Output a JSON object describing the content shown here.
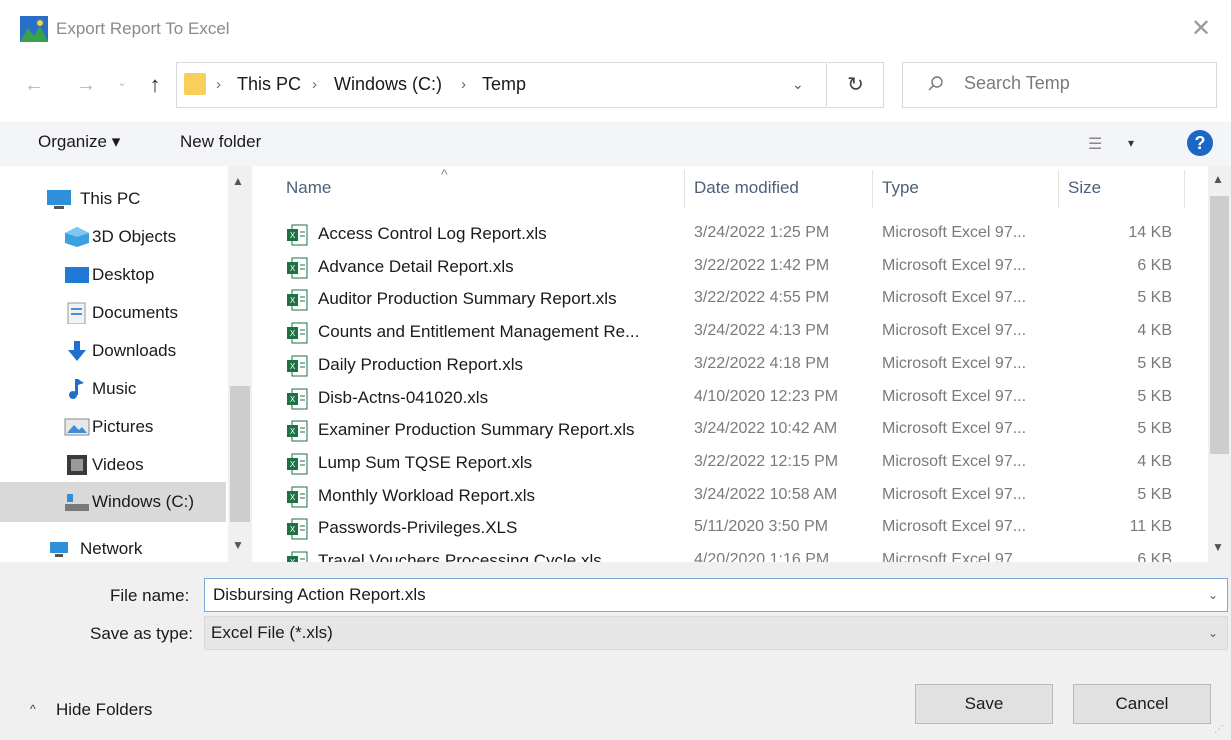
{
  "window": {
    "title": "Export Report To Excel",
    "close_glyph": "✕"
  },
  "nav": {
    "back_glyph": "←",
    "forward_glyph": "→",
    "recent_glyph": "⌄",
    "up_glyph": "↑",
    "breadcrumb": [
      "This PC",
      "Windows (C:)",
      "Temp"
    ],
    "separator": "›",
    "dropdown_glyph": "⌄",
    "refresh_glyph": "↻"
  },
  "search": {
    "placeholder": "Search Temp"
  },
  "toolbar": {
    "organize": "Organize ▾",
    "new_folder": "New folder",
    "view_glyph": "☰",
    "view_caret": "▾",
    "help": "?"
  },
  "sidebar": {
    "items": [
      {
        "label": "This PC",
        "icon": "pc-icon"
      },
      {
        "label": "3D Objects",
        "icon": "cube-icon"
      },
      {
        "label": "Desktop",
        "icon": "desktop-icon"
      },
      {
        "label": "Documents",
        "icon": "documents-icon"
      },
      {
        "label": "Downloads",
        "icon": "download-icon"
      },
      {
        "label": "Music",
        "icon": "music-icon"
      },
      {
        "label": "Pictures",
        "icon": "pictures-icon"
      },
      {
        "label": "Videos",
        "icon": "videos-icon"
      },
      {
        "label": "Windows (C:)",
        "icon": "drive-icon",
        "selected": true
      },
      {
        "label": "Network",
        "icon": "network-icon"
      }
    ],
    "scroll_up": "▲",
    "scroll_down": "▼"
  },
  "file_list": {
    "columns": {
      "name": "Name",
      "date": "Date modified",
      "type": "Type",
      "size": "Size"
    },
    "sort_glyph": "^",
    "rows": [
      {
        "name": "Access Control Log Report.xls",
        "date": "3/24/2022 1:25 PM",
        "type": "Microsoft Excel 97...",
        "size": "14 KB"
      },
      {
        "name": "Advance Detail Report.xls",
        "date": "3/22/2022 1:42 PM",
        "type": "Microsoft Excel 97...",
        "size": "6 KB"
      },
      {
        "name": "Auditor Production Summary Report.xls",
        "date": "3/22/2022 4:55 PM",
        "type": "Microsoft Excel 97...",
        "size": "5 KB"
      },
      {
        "name": "Counts and Entitlement Management Re...",
        "date": "3/24/2022 4:13 PM",
        "type": "Microsoft Excel 97...",
        "size": "4 KB"
      },
      {
        "name": "Daily Production Report.xls",
        "date": "3/22/2022 4:18 PM",
        "type": "Microsoft Excel 97...",
        "size": "5 KB"
      },
      {
        "name": "Disb-Actns-041020.xls",
        "date": "4/10/2020 12:23 PM",
        "type": "Microsoft Excel 97...",
        "size": "5 KB"
      },
      {
        "name": "Examiner Production Summary Report.xls",
        "date": "3/24/2022 10:42 AM",
        "type": "Microsoft Excel 97...",
        "size": "5 KB"
      },
      {
        "name": "Lump Sum TQSE  Report.xls",
        "date": "3/22/2022 12:15 PM",
        "type": "Microsoft Excel 97...",
        "size": "4 KB"
      },
      {
        "name": "Monthly Workload Report.xls",
        "date": "3/24/2022 10:58 AM",
        "type": "Microsoft Excel 97...",
        "size": "5 KB"
      },
      {
        "name": "Passwords-Privileges.XLS",
        "date": "5/11/2020 3:50 PM",
        "type": "Microsoft Excel 97...",
        "size": "11 KB"
      },
      {
        "name": "Travel Vouchers Processing Cycle.xls",
        "date": "4/20/2020 1:16 PM",
        "type": "Microsoft Excel 97...",
        "size": "6 KB"
      }
    ],
    "scroll_up": "▲",
    "scroll_down": "▼"
  },
  "bottom": {
    "filename_label": "File name:",
    "filename_value": "Disbursing Action Report.xls",
    "savetype_label": "Save as type:",
    "savetype_value": "Excel File (*.xls)",
    "dropdown_glyph": "⌄",
    "hide_folders": "Hide Folders",
    "hide_caret": "^",
    "save": "Save",
    "cancel": "Cancel",
    "grip": "⋰"
  },
  "colors": {
    "accent": "#1a67c5",
    "folder": "#f7cf5a",
    "excel": "#1e7145",
    "selected": "#d9d9d9"
  }
}
